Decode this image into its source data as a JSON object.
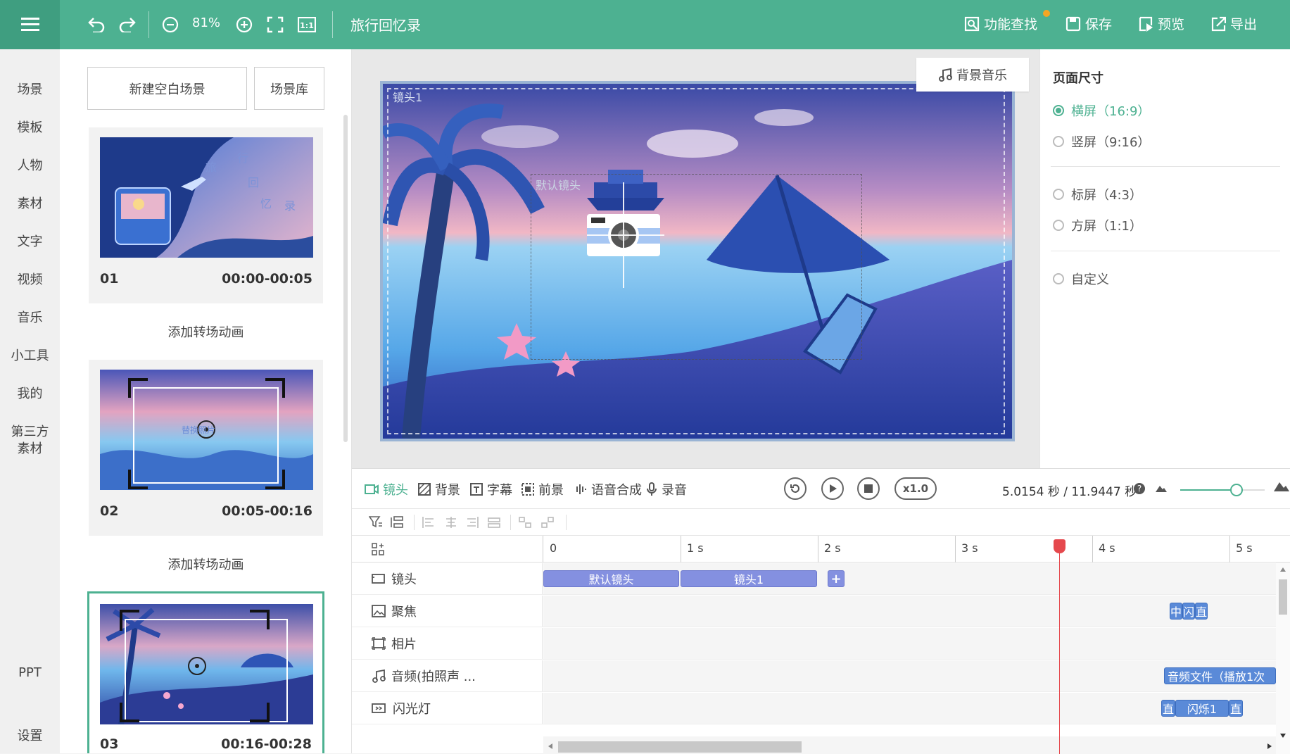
{
  "app": {
    "title": "旅行回忆录",
    "zoom": "81%",
    "actions": {
      "find": "功能查找",
      "save": "保存",
      "preview": "预览",
      "export": "导出"
    },
    "colors": {
      "accent": "#4db191",
      "clip": "#8490e0",
      "clip_blue": "#5a8ad8",
      "playhead": "#e5484d"
    }
  },
  "sidebar": {
    "items": [
      "场景",
      "模板",
      "人物",
      "素材",
      "文字",
      "视频",
      "音乐",
      "小工具",
      "我的",
      "第三方素材",
      "PPT",
      "设置"
    ]
  },
  "scenes": {
    "new_blank": "新建空白场景",
    "library": "场景库",
    "add_transition": "添加转场动画",
    "list": [
      {
        "num": "01",
        "time": "00:00-00:05",
        "thumb_text": "旅行回忆录"
      },
      {
        "num": "02",
        "time": "00:05-00:16",
        "thumb_text": "替换照片"
      },
      {
        "num": "03",
        "time": "00:16-00:28",
        "thumb_text": "替换照片",
        "active": true
      }
    ]
  },
  "canvas": {
    "bgm_button": "背景音乐",
    "stage_label": "镜头1",
    "default_lens_label": "默认镜头"
  },
  "props": {
    "title": "页面尺寸",
    "options": [
      {
        "label": "横屏（16:9）",
        "selected": true
      },
      {
        "label": "竖屏（9:16）",
        "selected": false
      },
      {
        "label": "标屏（4:3）",
        "selected": false
      },
      {
        "label": "方屏（1:1）",
        "selected": false
      },
      {
        "label": "自定义",
        "selected": false
      }
    ]
  },
  "timeline": {
    "tabs": [
      "镜头",
      "背景",
      "字幕",
      "前景",
      "语音合成",
      "录音"
    ],
    "active_tab": "镜头",
    "speed": "x1.0",
    "time_readout": "5.0154 秒 / 11.9447 秒",
    "help": "?",
    "ruler": [
      "0",
      "1 s",
      "2 s",
      "3 s",
      "4 s",
      "5 s"
    ],
    "tracks": [
      {
        "label": "镜头",
        "icon": "camera-frame-icon",
        "clips": [
          "默认镜头",
          "镜头1"
        ],
        "add": "+"
      },
      {
        "label": "聚焦",
        "icon": "image-icon",
        "clips": [
          "中",
          "闪",
          "直"
        ]
      },
      {
        "label": "相片",
        "icon": "photo-frame-icon",
        "clips": []
      },
      {
        "label": "音频(拍照声 ...",
        "icon": "music-note-icon",
        "clips": [
          "音频文件（播放1次"
        ]
      },
      {
        "label": "闪光灯",
        "icon": "flash-icon",
        "clips": [
          "直",
          "闪烁1",
          "直"
        ]
      }
    ],
    "playhead_seconds": 5.0154,
    "zoom_level": 0.6
  }
}
